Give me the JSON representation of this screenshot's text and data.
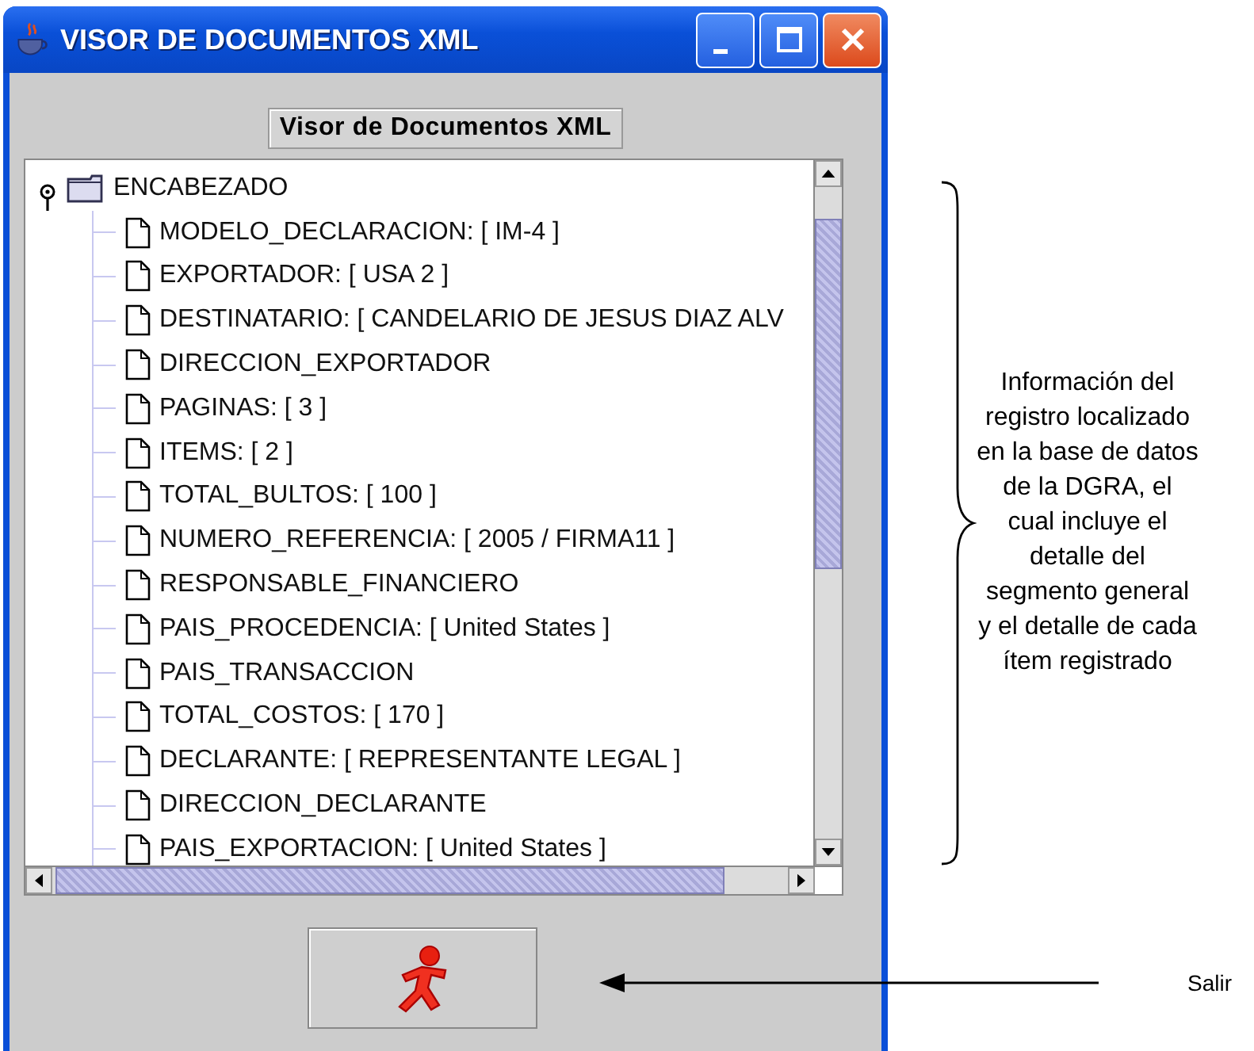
{
  "window": {
    "title": "VISOR DE DOCUMENTOS XML"
  },
  "heading": "Visor de Documentos XML",
  "tree": {
    "label": "ENCABEZADO",
    "expanded": true,
    "children": [
      {
        "label": "MODELO_DECLARACION: [ IM-4 ]"
      },
      {
        "label": "EXPORTADOR: [ USA 2 ]"
      },
      {
        "label": "DESTINATARIO: [ CANDELARIO DE JESUS DIAZ ALV"
      },
      {
        "label": "DIRECCION_EXPORTADOR"
      },
      {
        "label": "PAGINAS: [ 3 ]"
      },
      {
        "label": "ITEMS: [ 2 ]"
      },
      {
        "label": "TOTAL_BULTOS: [ 100 ]"
      },
      {
        "label": "NUMERO_REFERENCIA: [ 2005 / FIRMA11 ]"
      },
      {
        "label": "RESPONSABLE_FINANCIERO"
      },
      {
        "label": "PAIS_PROCEDENCIA: [ United States ]"
      },
      {
        "label": "PAIS_TRANSACCION"
      },
      {
        "label": "TOTAL_COSTOS: [ 170 ]"
      },
      {
        "label": "DECLARANTE: [ REPRESENTANTE LEGAL ]"
      },
      {
        "label": "DIRECCION_DECLARANTE"
      },
      {
        "label": "PAIS_EXPORTACION: [ United States ]"
      }
    ]
  },
  "annotations": [
    {
      "kind": "brace",
      "text": "Información del registro localizado en la base de datos de la DGRA, el cual incluye el detalle del segmento general y el detalle de cada ítem registrado"
    },
    {
      "kind": "arrow",
      "text": "Salir"
    }
  ]
}
